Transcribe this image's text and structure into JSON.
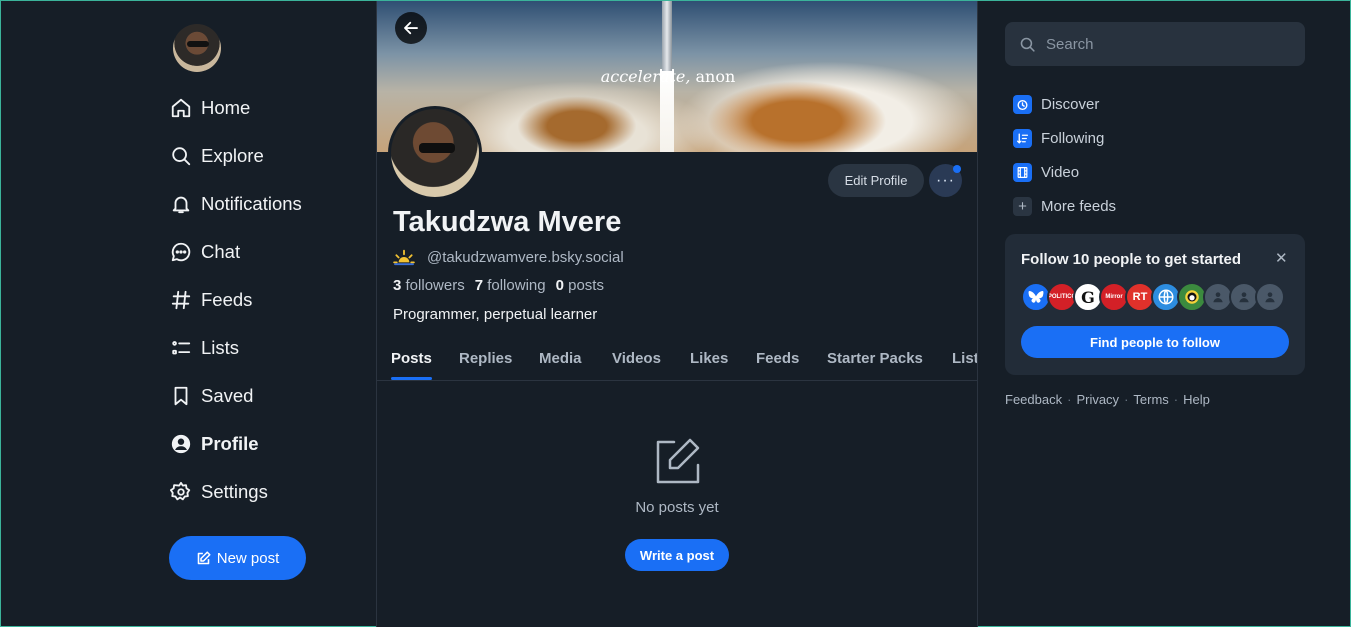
{
  "nav": {
    "items": [
      {
        "label": "Home",
        "icon": "home-icon"
      },
      {
        "label": "Explore",
        "icon": "search-icon"
      },
      {
        "label": "Notifications",
        "icon": "bell-icon"
      },
      {
        "label": "Chat",
        "icon": "chat-icon"
      },
      {
        "label": "Feeds",
        "icon": "hash-icon"
      },
      {
        "label": "Lists",
        "icon": "list-icon"
      },
      {
        "label": "Saved",
        "icon": "bookmark-icon"
      },
      {
        "label": "Profile",
        "icon": "user-circle-icon",
        "active": true
      },
      {
        "label": "Settings",
        "icon": "gear-icon"
      }
    ],
    "new_post_label": "New post"
  },
  "profile": {
    "banner_text_em": "accelerate,",
    "banner_text_rest": " anon",
    "edit_label": "Edit Profile",
    "more_label": "···",
    "display_name": "Takudzwa Mvere",
    "handle": "@takudzwamvere.bsky.social",
    "followers_count": "3",
    "followers_label": "followers",
    "following_count": "7",
    "following_label": "following",
    "posts_count": "0",
    "posts_label": "posts",
    "bio": "Programmer, perpetual learner"
  },
  "tabs": [
    "Posts",
    "Replies",
    "Media",
    "Videos",
    "Likes",
    "Feeds",
    "Starter Packs",
    "Lists"
  ],
  "empty": {
    "text": "No posts yet",
    "button": "Write a post"
  },
  "search": {
    "placeholder": "Search"
  },
  "feeds": [
    {
      "label": "Discover",
      "icon": "discover-icon"
    },
    {
      "label": "Following",
      "icon": "sort-icon"
    },
    {
      "label": "Video",
      "icon": "film-icon"
    },
    {
      "label": "More feeds",
      "icon": "plus-icon"
    }
  ],
  "follow_card": {
    "title": "Follow 10 people to get started",
    "close": "✕",
    "avatar_labels": [
      "",
      "POLITICO",
      "G",
      "Mirror",
      "RT",
      "",
      "",
      "",
      "",
      ""
    ],
    "button": "Find people to follow"
  },
  "footer": [
    "Feedback",
    "Privacy",
    "Terms",
    "Help"
  ],
  "colors": {
    "accent": "#1a6ff5",
    "background": "#161e27",
    "card": "#222c38"
  }
}
